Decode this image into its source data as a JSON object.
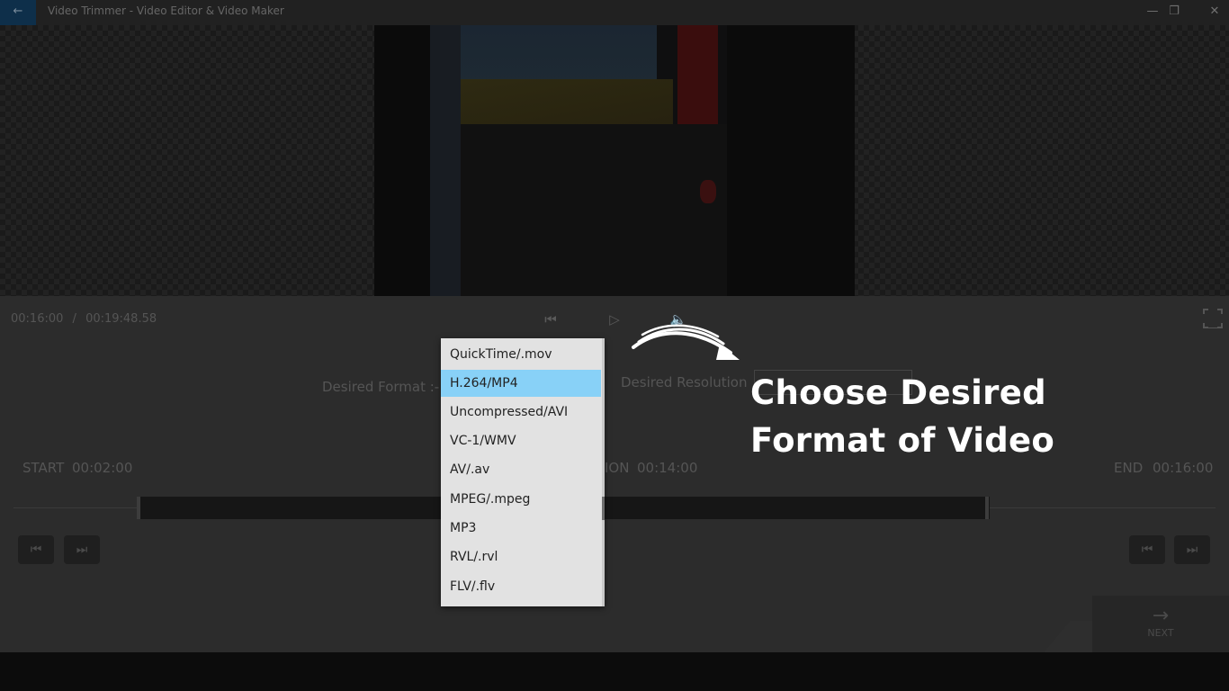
{
  "window": {
    "title": "Video Trimmer - Video Editor & Video Maker",
    "back_icon": "←",
    "minimize_icon": "—",
    "restore_icon": "❐",
    "close_icon": "✕"
  },
  "player": {
    "current_time": "00:16:00",
    "separator": "/",
    "total_time": "00:19:48.58"
  },
  "options": {
    "format_label": "Desired Format :-",
    "resolution_label": "Desired Resolution"
  },
  "timeline": {
    "start_label": "START",
    "start_value": "00:02:00",
    "duration_label": "ION",
    "duration_value": "00:14:00",
    "end_label": "END",
    "end_value": "00:16:00"
  },
  "next_button": {
    "label": "NEXT",
    "icon": "→"
  },
  "format_dropdown": {
    "selected": "H.264/MP4",
    "options": [
      "QuickTime/.mov",
      "H.264/MP4",
      "Uncompressed/AVI",
      "VC-1/WMV",
      "AV/.av",
      "MPEG/.mpeg",
      "MP3",
      "RVL/.rvl",
      "FLV/.flv"
    ]
  },
  "callout": {
    "line1": "Choose Desired",
    "line2": "Format of Video"
  },
  "colors": {
    "selected_option": "#88d1f7",
    "callout_text": "#ffffff",
    "app_background": "#2c2c2c"
  }
}
